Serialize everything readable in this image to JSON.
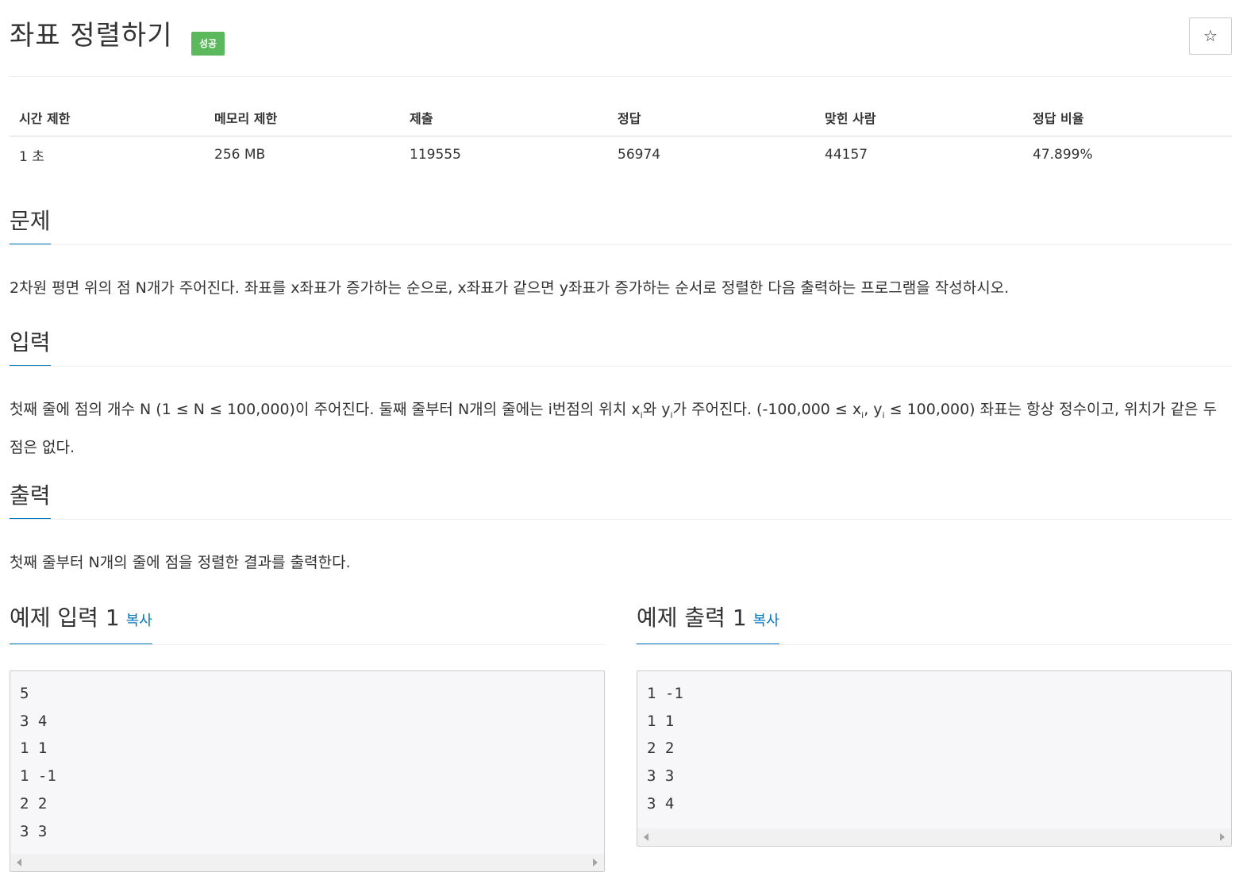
{
  "problem": {
    "title": "좌표 정렬하기",
    "status_badge": "성공",
    "star_icon": "☆"
  },
  "info_table": {
    "headers": [
      "시간 제한",
      "메모리 제한",
      "제출",
      "정답",
      "맞힌 사람",
      "정답 비율"
    ],
    "values": [
      "1 초",
      "256 MB",
      "119555",
      "56974",
      "44157",
      "47.899%"
    ]
  },
  "sections": {
    "problem": {
      "heading": "문제",
      "text": "2차원 평면 위의 점 N개가 주어진다. 좌표를 x좌표가 증가하는 순으로, x좌표가 같으면 y좌표가 증가하는 순서로 정렬한 다음 출력하는 프로그램을 작성하시오."
    },
    "input": {
      "heading": "입력",
      "part1": "첫째 줄에 점의 개수 N (1 ≤ N ≤ 100,000)이 주어진다. 둘째 줄부터 N개의 줄에는 i번점의 위치 x",
      "sub1": "i",
      "part2": "와 y",
      "sub2": "i",
      "part3": "가 주어진다. (-100,000 ≤ x",
      "sub3": "i",
      "part4": ", y",
      "sub4": "i",
      "part5": " ≤ 100,000) 좌표는 항상 정수이고, 위치가 같은 두 점은 없다."
    },
    "output": {
      "heading": "출력",
      "text": "첫째 줄부터 N개의 줄에 점을 정렬한 결과를 출력한다."
    }
  },
  "samples": {
    "input": {
      "heading": "예제 입력 1",
      "copy_label": "복사",
      "content": "5\n3 4\n1 1\n1 -1\n2 2\n3 3"
    },
    "output": {
      "heading": "예제 출력 1",
      "copy_label": "복사",
      "content": "1 -1\n1 1\n2 2\n3 3\n3 4"
    }
  },
  "colors": {
    "accent": "#0076c0",
    "success": "#5cb85c",
    "sample_bg": "#f7f7f9"
  }
}
